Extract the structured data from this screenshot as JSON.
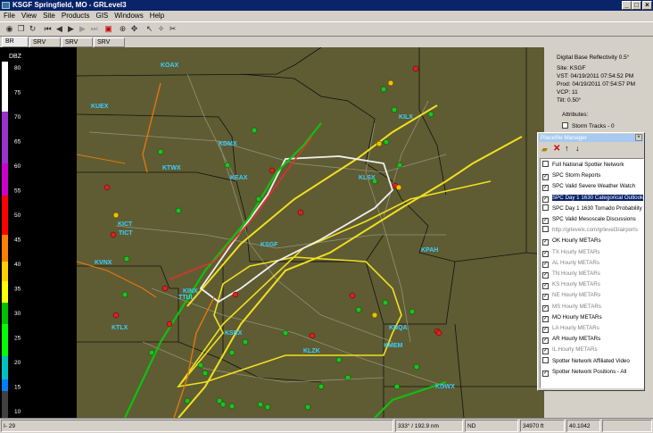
{
  "window": {
    "title": "KSGF Springfield, MO - GRLevel3"
  },
  "menu": [
    "File",
    "View",
    "Site",
    "Products",
    "GIS",
    "Windows",
    "Help"
  ],
  "tabs": [
    "BR 0.5°",
    "SRV 0.5°",
    "SRV 1.5°",
    "SRV 2.5°"
  ],
  "legend": {
    "unit": "DBZ",
    "ticks": [
      "80",
      "75",
      "70",
      "65",
      "60",
      "55",
      "50",
      "45",
      "40",
      "35",
      "30",
      "25",
      "20",
      "15",
      "10"
    ]
  },
  "radar_sites": [
    "KOAX",
    "KUEX",
    "KDMX",
    "KTWX",
    "KEAX",
    "KLSX",
    "KILX",
    "KICT",
    "KVNX",
    "KINX",
    "KSGF",
    "KSRX",
    "KLZK",
    "KPAH",
    "KTLX",
    "KNQA",
    "KGWX",
    "KMEM",
    "TICT",
    "TTUL"
  ],
  "info": {
    "product": "Digital Base Reflectivity 0.5°",
    "site": "Site:  KSGF",
    "vst": "VST:  04/19/2011   07:54:52 PM",
    "prod": "Prod: 04/19/2011   07:54:57 PM",
    "vcp": "VCP:  11",
    "tilt": "Tilt:   0.50°",
    "attributes": "Attributes:",
    "storm_tracks": "Storm Tracks - 0"
  },
  "placefile_manager": {
    "title": "Placefile Manager",
    "items": [
      {
        "label": "Full National Spotter Network",
        "checked": false,
        "dim": false
      },
      {
        "label": "SPC Storm Reports",
        "checked": true,
        "dim": false
      },
      {
        "label": "SPC Valid Severe Weather Watch",
        "checked": true,
        "dim": false
      },
      {
        "label": "SPC Day 1 1630 Categorical Outlook",
        "checked": true,
        "dim": false,
        "selected": true
      },
      {
        "label": "SPC Day 1 1630 Tornado Probability",
        "checked": false,
        "dim": false
      },
      {
        "label": "SPC Valid Mesoscale Discussions",
        "checked": true,
        "dim": false
      },
      {
        "label": "http://grlevelx.com/grlevel3/airports",
        "checked": false,
        "dim": true
      },
      {
        "label": "OK Hourly METARs",
        "checked": true,
        "dim": false
      },
      {
        "label": "TX Hourly METARs",
        "checked": true,
        "dim": true
      },
      {
        "label": "AL Hourly METARs",
        "checked": true,
        "dim": true
      },
      {
        "label": "TN Hourly METARs",
        "checked": true,
        "dim": true
      },
      {
        "label": "KS Hourly METARs",
        "checked": true,
        "dim": true
      },
      {
        "label": "NE Hourly METARs",
        "checked": true,
        "dim": true
      },
      {
        "label": "MS Hourly METARs",
        "checked": true,
        "dim": true
      },
      {
        "label": "MO Hourly METARs",
        "checked": true,
        "dim": false
      },
      {
        "label": "LA Hourly METARs",
        "checked": true,
        "dim": true
      },
      {
        "label": "AR Hourly METARs",
        "checked": true,
        "dim": false
      },
      {
        "label": "IL Hourly METARs",
        "checked": true,
        "dim": true
      },
      {
        "label": "Spotter Network Affiliated Video",
        "checked": false,
        "dim": false
      },
      {
        "label": "Spotter Network Positions - All",
        "checked": true,
        "dim": false
      }
    ]
  },
  "status": {
    "left": "I- 29",
    "bearing": "333° / 192.9 nm",
    "nd": "ND",
    "altitude": "34970 ft",
    "coords": "40.1042"
  },
  "colors": {
    "map_bg": "#5f5c33",
    "tornado_watch": "#e03030",
    "severe_watch": "#f0e020",
    "outlook_green": "#10c010",
    "outlook_white": "#f0f0f0",
    "orange_front": "#e07810"
  }
}
